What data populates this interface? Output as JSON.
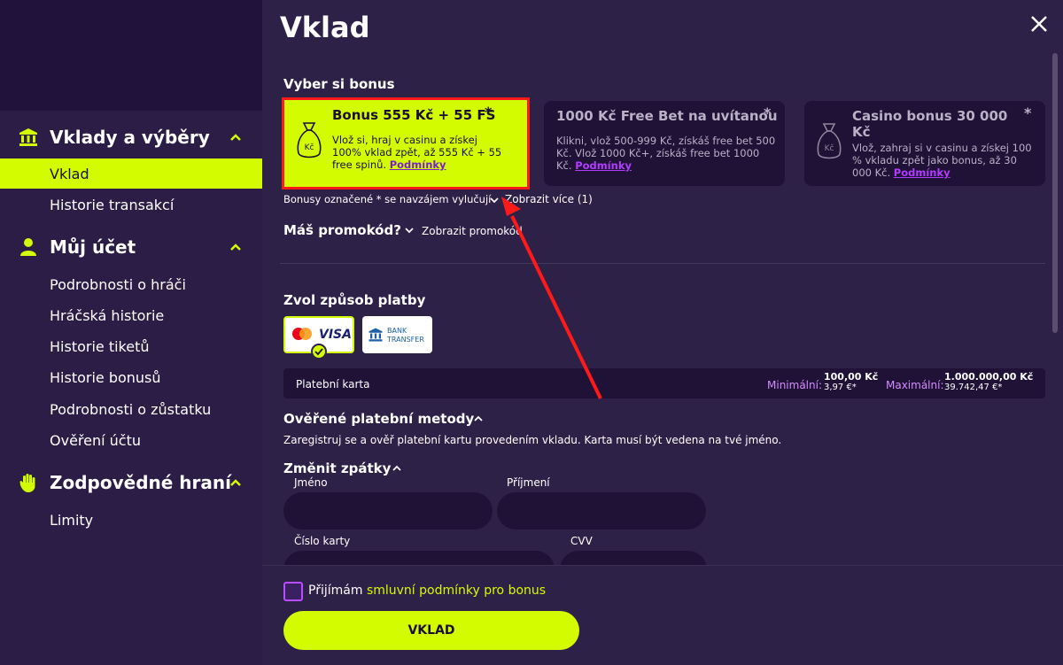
{
  "sidebar": {
    "sections": [
      {
        "title": "Vklady a výběry",
        "icon": "bank-icon",
        "items": [
          "Vklad",
          "Historie transakcí"
        ]
      },
      {
        "title": "Můj účet",
        "icon": "user-icon",
        "items": [
          "Podrobnosti o hráči",
          "Hráčská historie",
          "Historie tiketů",
          "Historie bonusů",
          "Podrobnosti o zůstatku",
          "Ověření účtu"
        ]
      },
      {
        "title": "Zodpovědné hraní",
        "icon": "hand-icon",
        "items": [
          "Limity"
        ]
      }
    ],
    "active_item": "Vklad"
  },
  "main": {
    "title": "Vklad",
    "bonus_heading": "Vyber si bonus",
    "bonuses": [
      {
        "title": "Bonus 555 Kč + 55 FS",
        "star": "*",
        "desc": "Vlož si, hraj v casinu a získej 100% vklad zpět, až 555 Kč + 55 free spinů.",
        "link": "Podmínky",
        "bag_label": "Kč"
      },
      {
        "title": "1000 Kč Free Bet na uvítanou",
        "star": "*",
        "desc": "Klikni, vlož 500-999 Kč, získáš free bet 500 Kč. Vlož 1000 Kč+, získáš free bet 1000 Kč.",
        "link": "Podmínky"
      },
      {
        "title": "Casino bonus 30 000 Kč",
        "star": "*",
        "desc": "Vlož, zahraj si v casinu a získej 100 % vkladu zpět jako bonus, až 30 000 Kč.",
        "link": "Podmínky",
        "bag_label": "Kč"
      }
    ],
    "exclusive_note": "Bonusy označené * se navzájem vylučují",
    "show_more": "Zobrazit více (1)",
    "promo_heading": "Máš promokód?",
    "promo_toggle": "Zobrazit promokód",
    "payment_heading": "Zvol způsob platby",
    "payment_methods": [
      {
        "name": "VISA",
        "icon": "mastercard-icon"
      },
      {
        "name": "BANK TRANSFER",
        "line1": "BANK",
        "line2": "TRANSFER",
        "icon": "bank-icon"
      }
    ],
    "card_bar": {
      "label": "Platební karta",
      "min_label": "Minimální:",
      "min_value": "100,00 Kč",
      "min_sub": "3,97 €*",
      "max_label": "Maximální:",
      "max_value": "1.000.000,00 Kč",
      "max_sub": "39.742,47 €*"
    },
    "verified_heading": "Ověřené platební metody",
    "verified_text": "Zaregistruj se a ověř platební kartu provedením vkladu. Karta musí být vedena na tvé jméno.",
    "change_heading": "Změnit zpátky",
    "fields": {
      "name_label": "Jméno",
      "surname_label": "Příjmení",
      "card_label": "Číslo karty",
      "cvv_label": "CVV"
    },
    "accept_prefix": "Přijímám",
    "accept_link": "smluvní podmínky pro bonus",
    "submit": "VKLAD"
  },
  "colors": {
    "accent": "#d4fc00",
    "background": "#2e2148",
    "sidebar": "#2b1d45",
    "highlight": "#ff1a1a",
    "link": "#b13cff"
  }
}
